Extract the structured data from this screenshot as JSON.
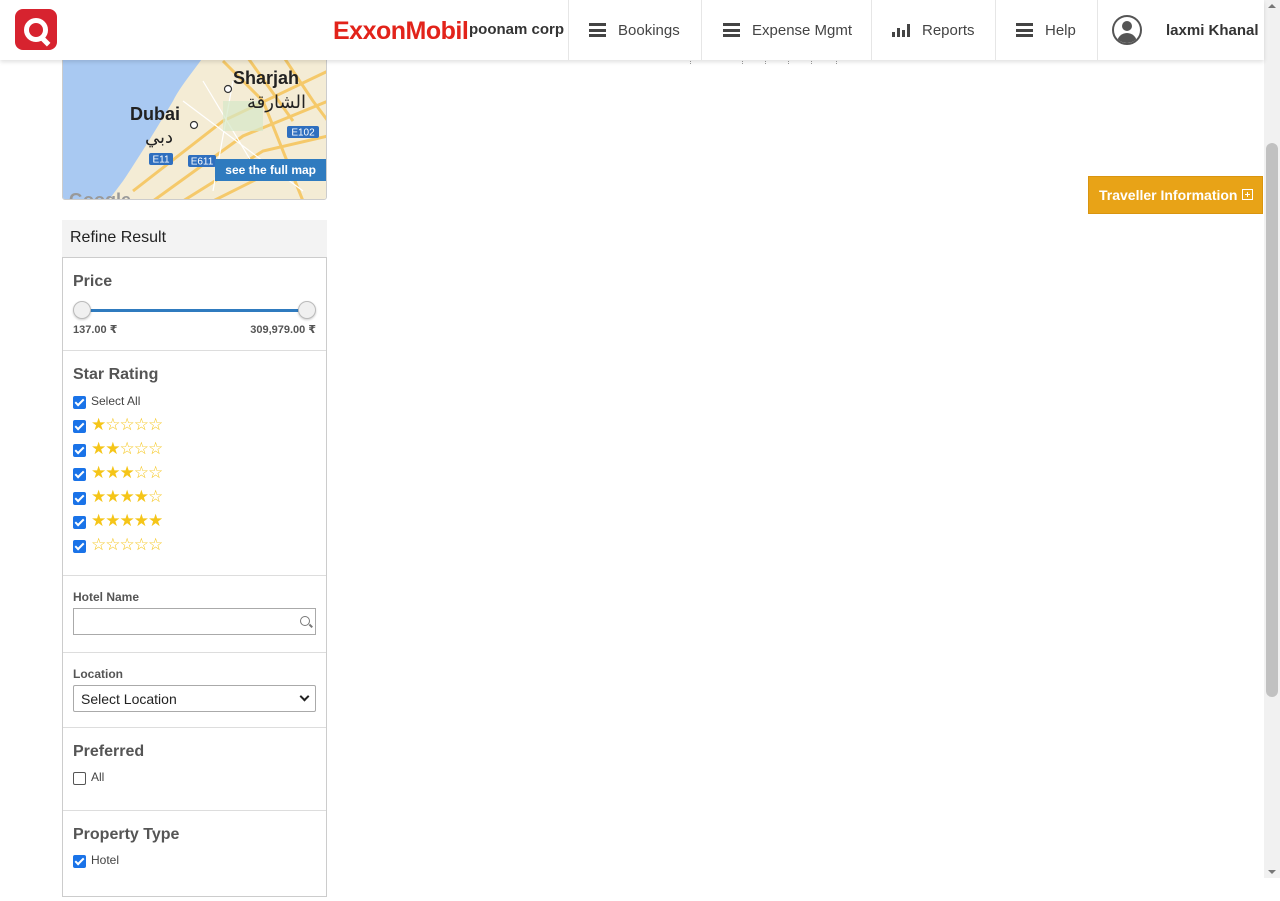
{
  "header": {
    "brand": "ExxonMobil",
    "corp": "poonam corp",
    "nav": [
      {
        "label": "Bookings"
      },
      {
        "label": "Expense Mgmt"
      },
      {
        "label": "Reports"
      },
      {
        "label": "Help"
      }
    ],
    "user_name": "laxmi Khanal"
  },
  "map": {
    "labels": {
      "city1": "Sharjah",
      "city1_ar": "الشارقة",
      "city2": "Dubai",
      "city2_ar": "دبي",
      "road1": "E102",
      "road2": "E11",
      "road3": "E611",
      "google": "Google"
    },
    "button": "see the full map"
  },
  "refine": {
    "title": "Refine Result",
    "price": {
      "title": "Price",
      "min": "137.00 ₹",
      "max": "309,979.00 ₹",
      "low_fraction": 0.0,
      "high_fraction": 1.0
    },
    "star_rating": {
      "title": "Star Rating",
      "select_all": "Select All",
      "options": [
        {
          "stars": "★☆☆☆☆",
          "checked": true
        },
        {
          "stars": "★★☆☆☆",
          "checked": true
        },
        {
          "stars": "★★★☆☆",
          "checked": true
        },
        {
          "stars": "★★★★☆",
          "checked": true
        },
        {
          "stars": "★★★★★",
          "checked": true
        },
        {
          "stars": "☆☆☆☆☆",
          "checked": true
        }
      ]
    },
    "hotel_name": {
      "title": "Hotel Name",
      "value": "",
      "placeholder": ""
    },
    "location": {
      "title": "Location",
      "selected": "Select Location"
    },
    "preferred": {
      "title": "Preferred",
      "option": "All",
      "checked": false
    },
    "property_type": {
      "title": "Property Type",
      "option": "Hotel",
      "checked": true
    }
  },
  "traveller_info": {
    "label": "Traveller Information"
  },
  "colors": {
    "accent": "#2f7bbf",
    "traveller": "#e8a317",
    "brand_red": "#e2231a",
    "star": "#f5c518"
  }
}
